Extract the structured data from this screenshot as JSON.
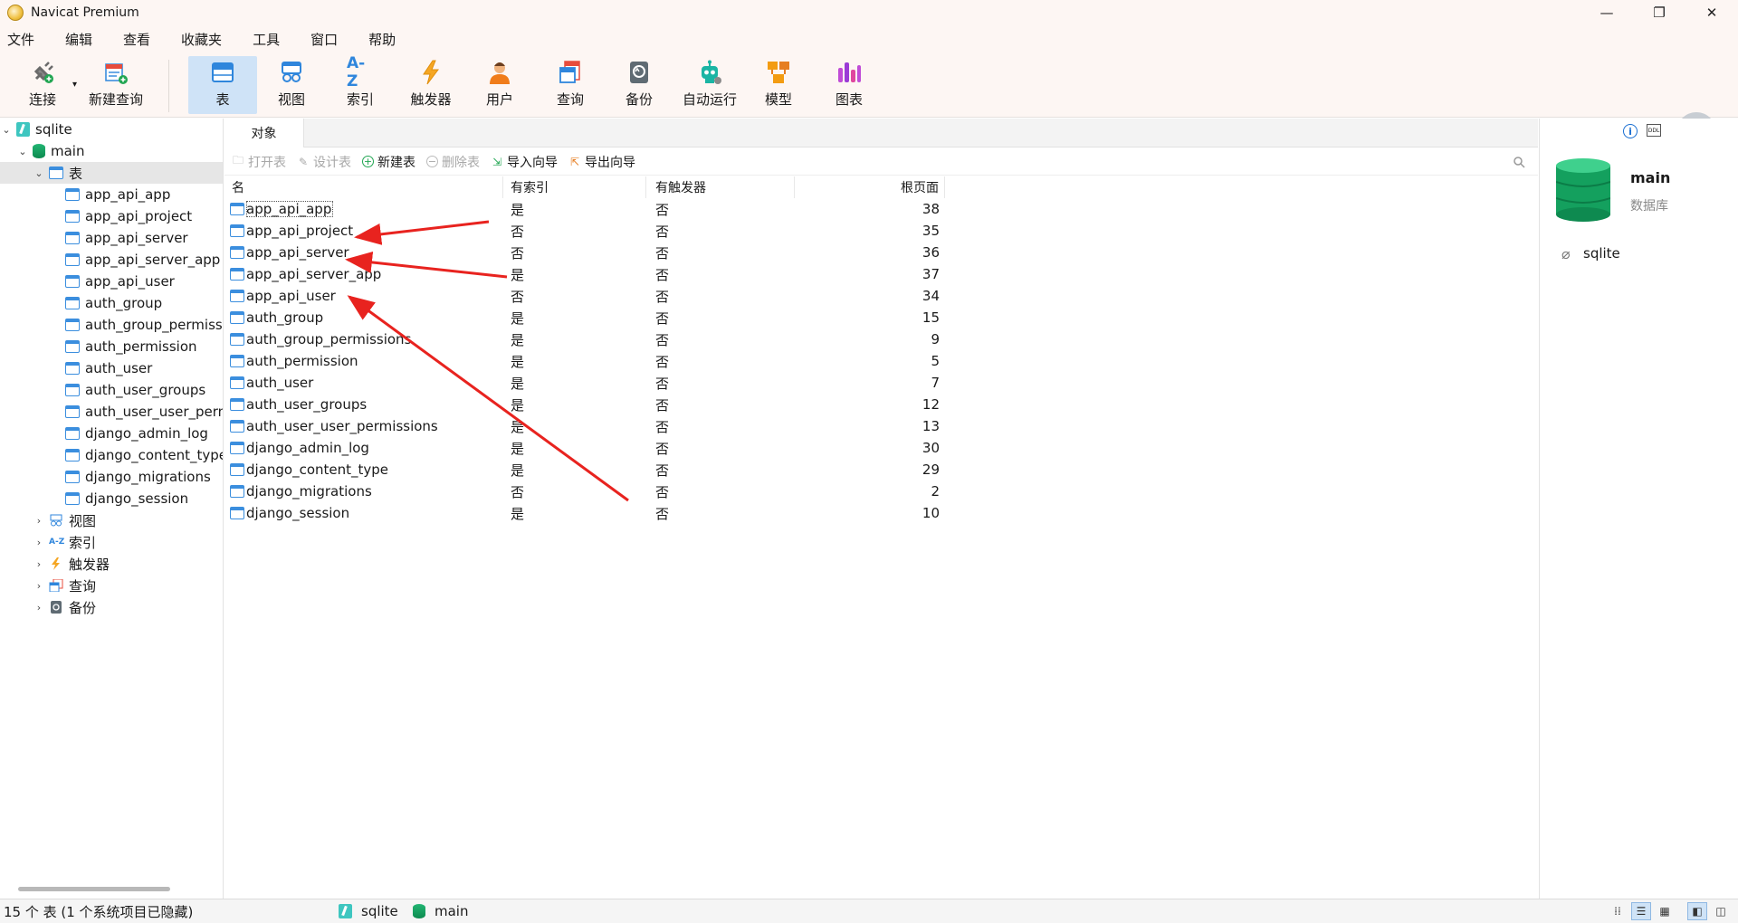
{
  "window": {
    "title": "Navicat Premium",
    "controls": [
      "—",
      "❐",
      "✕"
    ]
  },
  "menu": [
    "文件",
    "编辑",
    "查看",
    "收藏夹",
    "工具",
    "窗口",
    "帮助"
  ],
  "toolbar": {
    "connect": "连接",
    "new_query": "新建查询",
    "table": "表",
    "view": "视图",
    "index": "索引",
    "trigger": "触发器",
    "user": "用户",
    "query": "查询",
    "backup": "备份",
    "automation": "自动运行",
    "model": "模型",
    "chart": "图表",
    "index_icon_text": "A-Z"
  },
  "sidebar": {
    "connection": "sqlite",
    "database": "main",
    "tables_node": "表",
    "tables": [
      "app_api_app",
      "app_api_project",
      "app_api_server",
      "app_api_server_app",
      "app_api_user",
      "auth_group",
      "auth_group_permissi",
      "auth_permission",
      "auth_user",
      "auth_user_groups",
      "auth_user_user_perm",
      "django_admin_log",
      "django_content_type",
      "django_migrations",
      "django_session"
    ],
    "views_node": "视图",
    "indexes_node": "索引",
    "triggers_node": "触发器",
    "queries_node": "查询",
    "backups_node": "备份",
    "index_icon_text": "A-Z"
  },
  "main": {
    "tab": "对象",
    "actions": {
      "open_table": "打开表",
      "design_table": "设计表",
      "new_table": "新建表",
      "delete_table": "删除表",
      "import_wizard": "导入向导",
      "export_wizard": "导出向导"
    },
    "columns": {
      "name": "名",
      "has_index": "有索引",
      "has_trigger": "有触发器",
      "root_page": "根页面"
    },
    "rows": [
      {
        "name": "app_api_app",
        "has_index": "是",
        "has_trigger": "否",
        "root_page": "38"
      },
      {
        "name": "app_api_project",
        "has_index": "否",
        "has_trigger": "否",
        "root_page": "35"
      },
      {
        "name": "app_api_server",
        "has_index": "否",
        "has_trigger": "否",
        "root_page": "36"
      },
      {
        "name": "app_api_server_app",
        "has_index": "是",
        "has_trigger": "否",
        "root_page": "37"
      },
      {
        "name": "app_api_user",
        "has_index": "否",
        "has_trigger": "否",
        "root_page": "34"
      },
      {
        "name": "auth_group",
        "has_index": "是",
        "has_trigger": "否",
        "root_page": "15"
      },
      {
        "name": "auth_group_permissions",
        "has_index": "是",
        "has_trigger": "否",
        "root_page": "9"
      },
      {
        "name": "auth_permission",
        "has_index": "是",
        "has_trigger": "否",
        "root_page": "5"
      },
      {
        "name": "auth_user",
        "has_index": "是",
        "has_trigger": "否",
        "root_page": "7"
      },
      {
        "name": "auth_user_groups",
        "has_index": "是",
        "has_trigger": "否",
        "root_page": "12"
      },
      {
        "name": "auth_user_user_permissions",
        "has_index": "是",
        "has_trigger": "否",
        "root_page": "13"
      },
      {
        "name": "django_admin_log",
        "has_index": "是",
        "has_trigger": "否",
        "root_page": "30"
      },
      {
        "name": "django_content_type",
        "has_index": "是",
        "has_trigger": "否",
        "root_page": "29"
      },
      {
        "name": "django_migrations",
        "has_index": "否",
        "has_trigger": "否",
        "root_page": "2"
      },
      {
        "name": "django_session",
        "has_index": "是",
        "has_trigger": "否",
        "root_page": "10"
      }
    ]
  },
  "right_panel": {
    "name": "main",
    "type": "数据库",
    "connection": "sqlite",
    "ddl_label": "DDL"
  },
  "status": {
    "count": "15 个 表 (1 个系统项目已隐藏)",
    "connection": "sqlite",
    "database": "main"
  },
  "colors": {
    "accent": "#1a6fd1",
    "active_bg": "#cfe3f7",
    "arrow": "#e8231f",
    "db_green": "#14a05e"
  }
}
